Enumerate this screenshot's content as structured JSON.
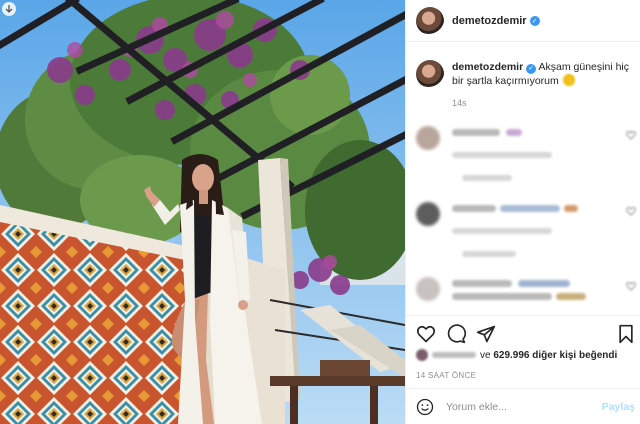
{
  "post": {
    "username": "demetozdemir",
    "verified": true,
    "caption_text": "Akşam güneşini hiç bir şartla kaçırmıyorum",
    "caption_emoji": "sun-emoji",
    "caption_time": "14s"
  },
  "likes": {
    "prefix": "ve",
    "count": "629.996",
    "suffix": "diğer kişi beğendi"
  },
  "time_ago": "14 SAAT ÖNCE",
  "comment_box": {
    "placeholder": "Yorum ekle...",
    "post_label": "Paylaş"
  },
  "icons": {
    "header_avatar": "avatar",
    "verified": "verified-badge-icon",
    "like": "heart-icon",
    "comment": "comment-icon",
    "share": "share-icon",
    "save": "bookmark-icon",
    "emoji": "smiley-icon",
    "scroll": "arrow-down-icon"
  },
  "colors": {
    "verified_blue": "#3897f0",
    "post_button_disabled": "#b2dffc",
    "muted_text": "#8e8e8e"
  }
}
